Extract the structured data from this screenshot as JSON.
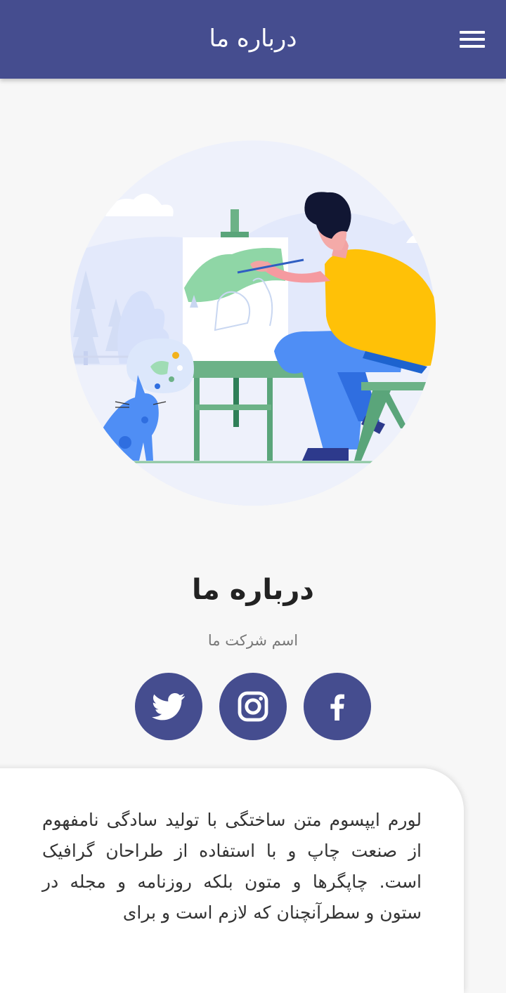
{
  "app_bar": {
    "title": "درباره ما",
    "menu_icon": "hamburger-menu-icon"
  },
  "hero": {
    "illustration": "artist-painting-on-easel-with-cat"
  },
  "about": {
    "heading": "درباره ما",
    "company_name": "اسم شرکت ما"
  },
  "social_links": [
    {
      "name": "twitter",
      "icon": "twitter-icon"
    },
    {
      "name": "instagram",
      "icon": "instagram-icon"
    },
    {
      "name": "facebook",
      "icon": "facebook-icon"
    }
  ],
  "description": {
    "text": "لورم ایپسوم متن ساختگی با تولید سادگی نامفهوم از صنعت چاپ و با استفاده از طراحان گرافیک است. چاپگرها و متون بلکه روزنامه و مجله در ستون و سطرآنچنان که لازم است و برای"
  },
  "colors": {
    "primary": "#454d8f",
    "background": "#f7f7f7",
    "card": "#ffffff"
  }
}
